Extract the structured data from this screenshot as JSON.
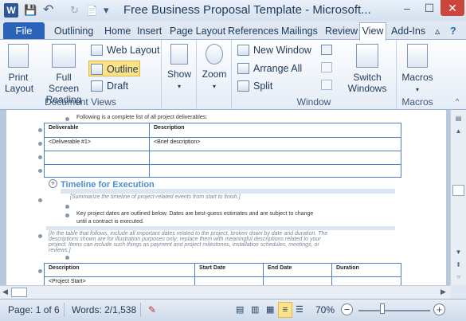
{
  "titlebar": {
    "app_icon": "W",
    "title": "Free Business Proposal Template  -  Microsoft...",
    "qa_save": "💾",
    "qa_undo": "↶",
    "qa_redo": "↻",
    "qa_new": "📄",
    "qa_more": "▾",
    "min": "–",
    "max": "☐",
    "close": "✕"
  },
  "tabs": {
    "file": "File",
    "items": [
      "Outlining",
      "Home",
      "Insert",
      "Page Layout",
      "References",
      "Mailings",
      "Review"
    ],
    "view": "View",
    "addins": "Add-Ins",
    "minimize_ribbon": "▵",
    "help": "?"
  },
  "ribbon": {
    "doc_views": {
      "print_layout": "Print Layout",
      "full_screen": "Full Screen Reading",
      "web_layout": "Web Layout",
      "outline": "Outline",
      "draft": "Draft",
      "label": "Document Views"
    },
    "show": "Show",
    "zoom": "Zoom",
    "window": {
      "new_window": "New Window",
      "arrange_all": "Arrange All",
      "split": "Split",
      "switch_windows": "Switch Windows",
      "label": "Window"
    },
    "macros": {
      "button": "Macros",
      "label": "Macros"
    }
  },
  "document": {
    "list_intro": "Following is a complete list of all project deliverables:",
    "table1": {
      "headers": [
        "Deliverable",
        "Description"
      ],
      "row1": [
        "<Deliverable #1>",
        "<Brief description>"
      ]
    },
    "heading": "Timeline for Execution",
    "summary_hint": "[Summarize the timeline of project-related events from start to finish.]",
    "key_dates": "Key project dates are outlined below. Dates are best-guess estimates and are subject to change",
    "key_dates_2": "until a contract is executed.",
    "table_hint": "[In the table that follows, include all important dates related to the project, broken down by date and duration. The",
    "table_hint_2": "descriptions shown are for illustration purposes only; replace them with meaningful descriptions related to your",
    "table_hint_3": "project. Items can include such things as payment and project milestones, installation schedules, meetings, or",
    "table_hint_4": "reviews.]",
    "table2": {
      "headers": [
        "Description",
        "Start Date",
        "End Date",
        "Duration"
      ],
      "row1": "<Project Start>"
    }
  },
  "status": {
    "page": "Page: 1 of 6",
    "words": "Words: 2/1,538",
    "zoom": "70%",
    "zoom_out": "−",
    "zoom_in": "+"
  }
}
